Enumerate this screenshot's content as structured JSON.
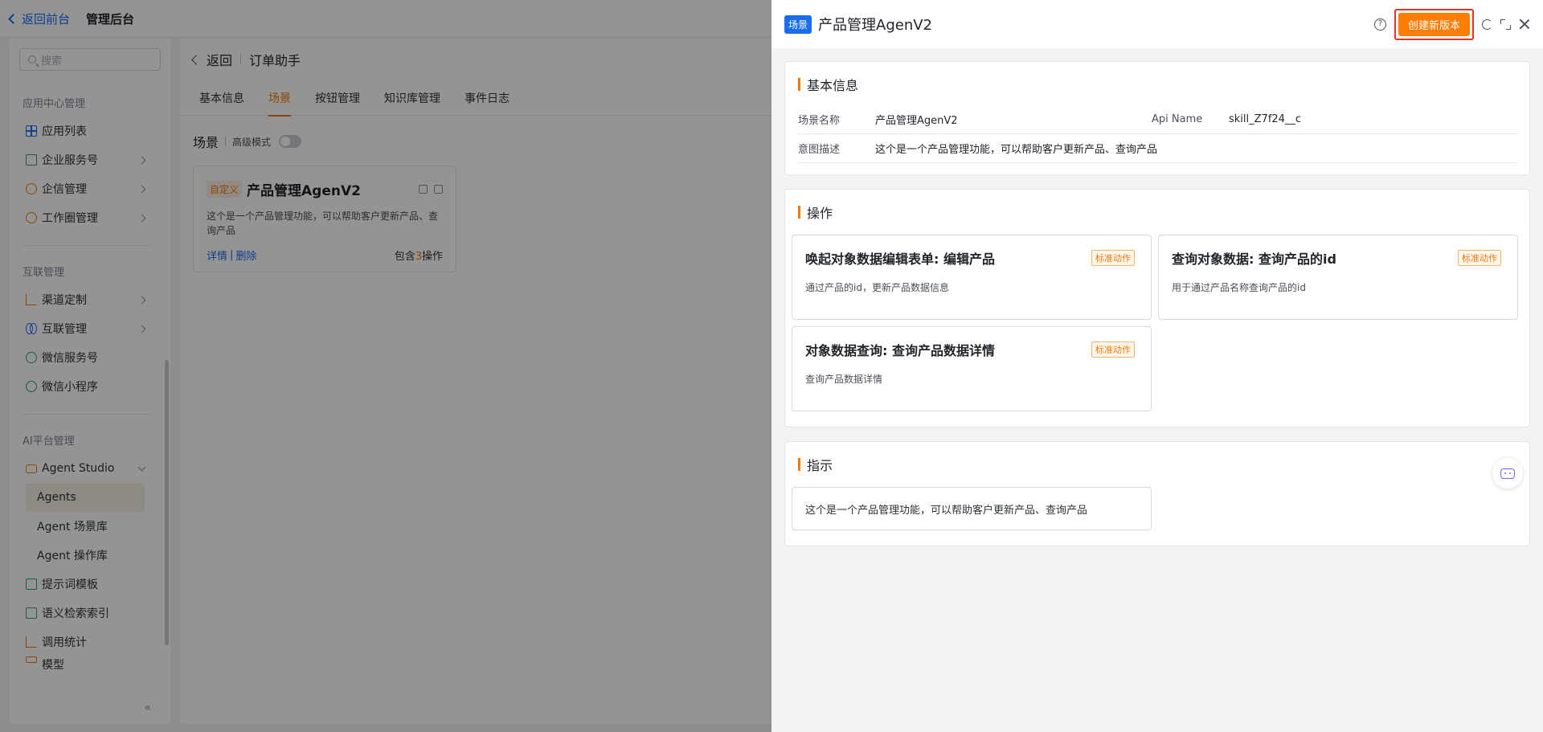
{
  "topbar": {
    "back_label": "返回前台",
    "title": "管理后台"
  },
  "sidebar": {
    "search_placeholder": "搜索",
    "groups": [
      {
        "title": "应用中心管理",
        "items": [
          "应用列表",
          "企业服务号",
          "企信管理",
          "工作圈管理"
        ]
      },
      {
        "title": "互联管理",
        "items": [
          "渠道定制",
          "互联管理",
          "微信服务号",
          "微信小程序"
        ]
      },
      {
        "title": "AI平台管理",
        "items": [
          "Agent Studio",
          "Agents",
          "Agent 场景库",
          "Agent 操作库",
          "提示词模板",
          "语义检索索引",
          "调用统计",
          "模型"
        ]
      }
    ],
    "collapse_label": "«"
  },
  "main": {
    "back_label": "返回",
    "page_title": "订单助手",
    "tabs": [
      "基本信息",
      "场景",
      "按钮管理",
      "知识库管理",
      "事件日志"
    ],
    "active_tab": "场景",
    "scene_label": "场景",
    "advanced_label": "高级模式",
    "card": {
      "tag": "自定义",
      "title": "产品管理AgenV2",
      "desc": "这个是一个产品管理功能，可以帮助客户更新产品、查询产品",
      "detail_link": "详情",
      "delete_link": "删除",
      "contains_prefix": "包含",
      "contains_count": "3",
      "contains_suffix": "操作"
    }
  },
  "drawer": {
    "badge": "场景",
    "title": "产品管理AgenV2",
    "help_symbol": "?",
    "create_button": "创建新版本",
    "basic": {
      "title": "基本信息",
      "scene_name_label": "场景名称",
      "scene_name_value": "产品管理AgenV2",
      "api_name_label": "Api Name",
      "api_name_value": "skill_Z7f24__c",
      "intent_label": "意图描述",
      "intent_value": "这个是一个产品管理功能，可以帮助客户更新产品、查询产品"
    },
    "ops": {
      "title": "操作",
      "items": [
        {
          "title": "唤起对象数据编辑表单: 编辑产品",
          "tag": "标准动作",
          "desc": "通过产品的id，更新产品数据信息"
        },
        {
          "title": "查询对象数据: 查询产品的id",
          "tag": "标准动作",
          "desc": "用于通过产品名称查询产品的id"
        },
        {
          "title": "对象数据查询: 查询产品数据详情",
          "tag": "标准动作",
          "desc": "查询产品数据详情"
        }
      ]
    },
    "instruction": {
      "title": "指示",
      "text": "这个是一个产品管理功能，可以帮助客户更新产品、查询产品"
    }
  },
  "colors": {
    "accent": "#f07b0a",
    "primary": "#1a6cf0",
    "highlight_border": "#e2332b"
  }
}
